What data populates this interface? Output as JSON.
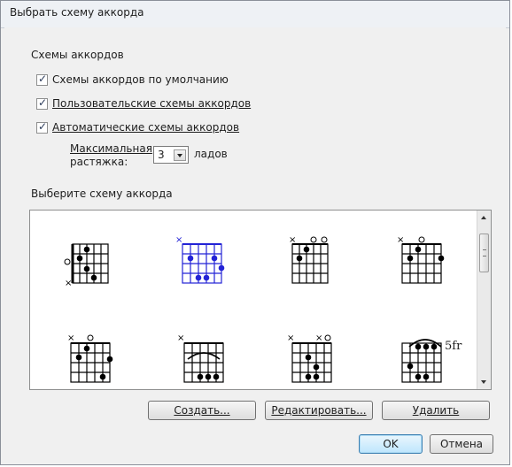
{
  "window": {
    "title": "Выбрать схему аккорда"
  },
  "schemes_group": {
    "label": "Схемы аккордов",
    "default_checkbox": "Схемы аккордов по умолчанию",
    "user_checkbox": "Пользовательские схемы аккордов",
    "auto_checkbox": "Автоматические схемы аккордов",
    "max_stretch_label_line1": "Максимальная",
    "max_stretch_label_line2": "растяжка:",
    "max_stretch_value": "3",
    "frets_label": "ладов"
  },
  "select_label": "Выберите схему аккорда",
  "chords": [
    {
      "name": "chord-1",
      "markers": [
        "",
        "",
        "",
        "",
        "",
        ""
      ]
    },
    {
      "name": "chord-2",
      "selected": true
    },
    {
      "name": "chord-3"
    },
    {
      "name": "chord-4"
    },
    {
      "name": "chord-5"
    },
    {
      "name": "chord-6"
    },
    {
      "name": "chord-7"
    },
    {
      "name": "chord-8",
      "fret_label": "5fr"
    }
  ],
  "buttons": {
    "create": "Создать...",
    "edit": "Редактировать...",
    "delete": "Удалить",
    "ok": "OK",
    "cancel": "Отмена"
  }
}
